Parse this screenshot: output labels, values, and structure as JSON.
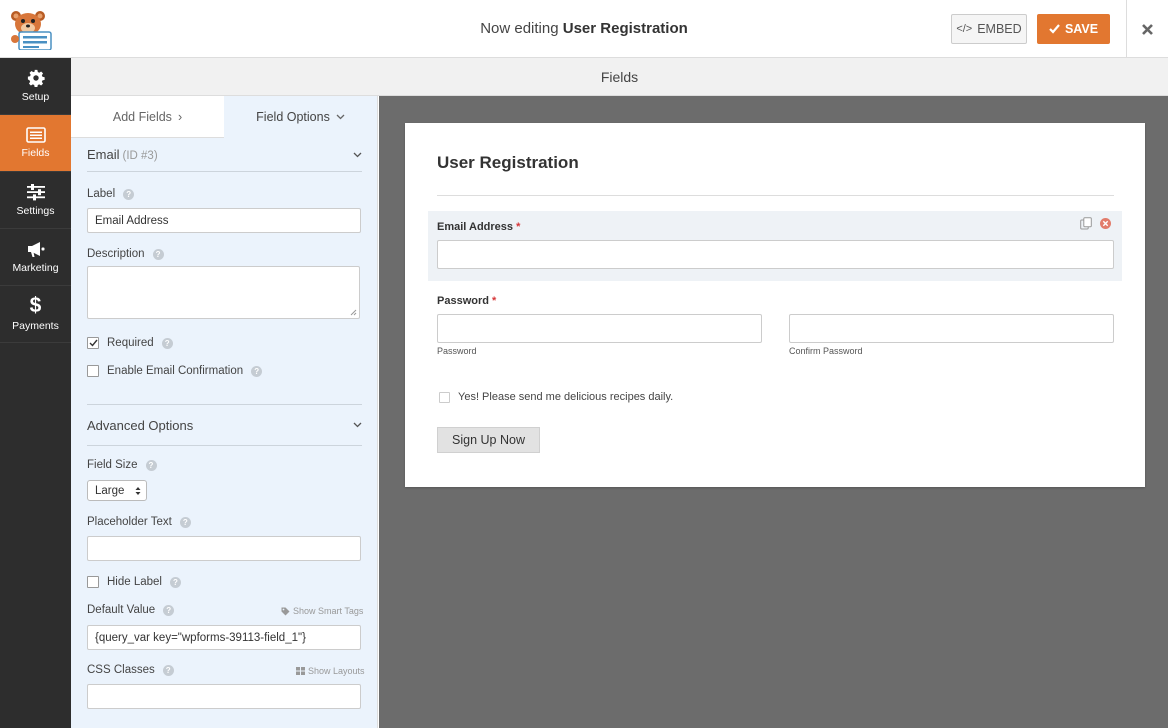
{
  "header": {
    "title_prefix": "Now editing",
    "title_name": "User Registration",
    "embed_label": "EMBED",
    "save_label": "SAVE",
    "accent_color": "#e27730"
  },
  "nav": {
    "items": [
      {
        "label": "Setup",
        "icon": "gear-icon"
      },
      {
        "label": "Fields",
        "icon": "list-icon",
        "active": true
      },
      {
        "label": "Settings",
        "icon": "sliders-icon"
      },
      {
        "label": "Marketing",
        "icon": "megaphone-icon"
      },
      {
        "label": "Payments",
        "icon": "dollar-icon"
      }
    ]
  },
  "section_title": "Fields",
  "panel": {
    "tabs": [
      {
        "label": "Add Fields",
        "chevron": "›"
      },
      {
        "label": "Field Options",
        "chevron": "⌄"
      }
    ],
    "field_name": "Email",
    "field_id": "(ID #3)",
    "label_label": "Label",
    "label_value": "Email Address",
    "description_label": "Description",
    "required_label": "Required",
    "required_checked": true,
    "confirmation_label": "Enable Email Confirmation",
    "advanced_title": "Advanced Options",
    "field_size_label": "Field Size",
    "field_size_value": "Large",
    "placeholder_label": "Placeholder Text",
    "hide_label_label": "Hide Label",
    "default_value_label": "Default Value",
    "show_smart_tags": "Show Smart Tags",
    "default_value": "{query_var key=\"wpforms-39113-field_1\"}",
    "css_classes_label": "CSS Classes",
    "show_layouts": "Show Layouts"
  },
  "form": {
    "title": "User Registration",
    "email_label": "Email Address",
    "password_label": "Password",
    "password_sublabel": "Password",
    "confirm_sublabel": "Confirm Password",
    "required_mark": "*",
    "optin_label": "Yes! Please send me delicious recipes daily.",
    "submit_label": "Sign Up Now"
  }
}
